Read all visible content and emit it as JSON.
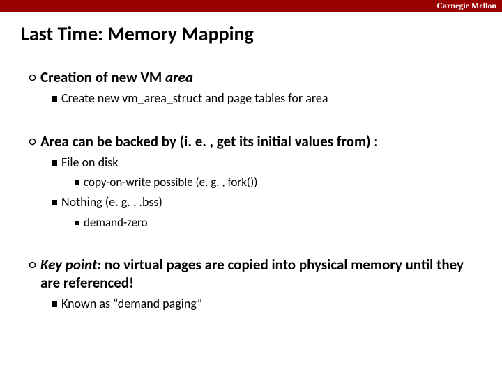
{
  "banner": {
    "text": "Carnegie Mellon"
  },
  "title": "Last Time: Memory Mapping",
  "s1": {
    "heading_plain": "Creation of new VM ",
    "heading_italic": "area",
    "p1": "Create new vm_area_struct and page tables for area"
  },
  "s2": {
    "heading": "Area can be backed by (i. e. , get its initial values from) :",
    "i1": "File on disk",
    "i1a": "copy-on-write possible (e. g. , fork())",
    "i2": "Nothing (e. g. , .bss)",
    "i2a": "demand-zero"
  },
  "s3": {
    "heading_italic": "Key point:",
    "heading_rest": " no virtual pages are copied into physical memory until they are referenced!",
    "p1": "Known as “demand paging”"
  }
}
